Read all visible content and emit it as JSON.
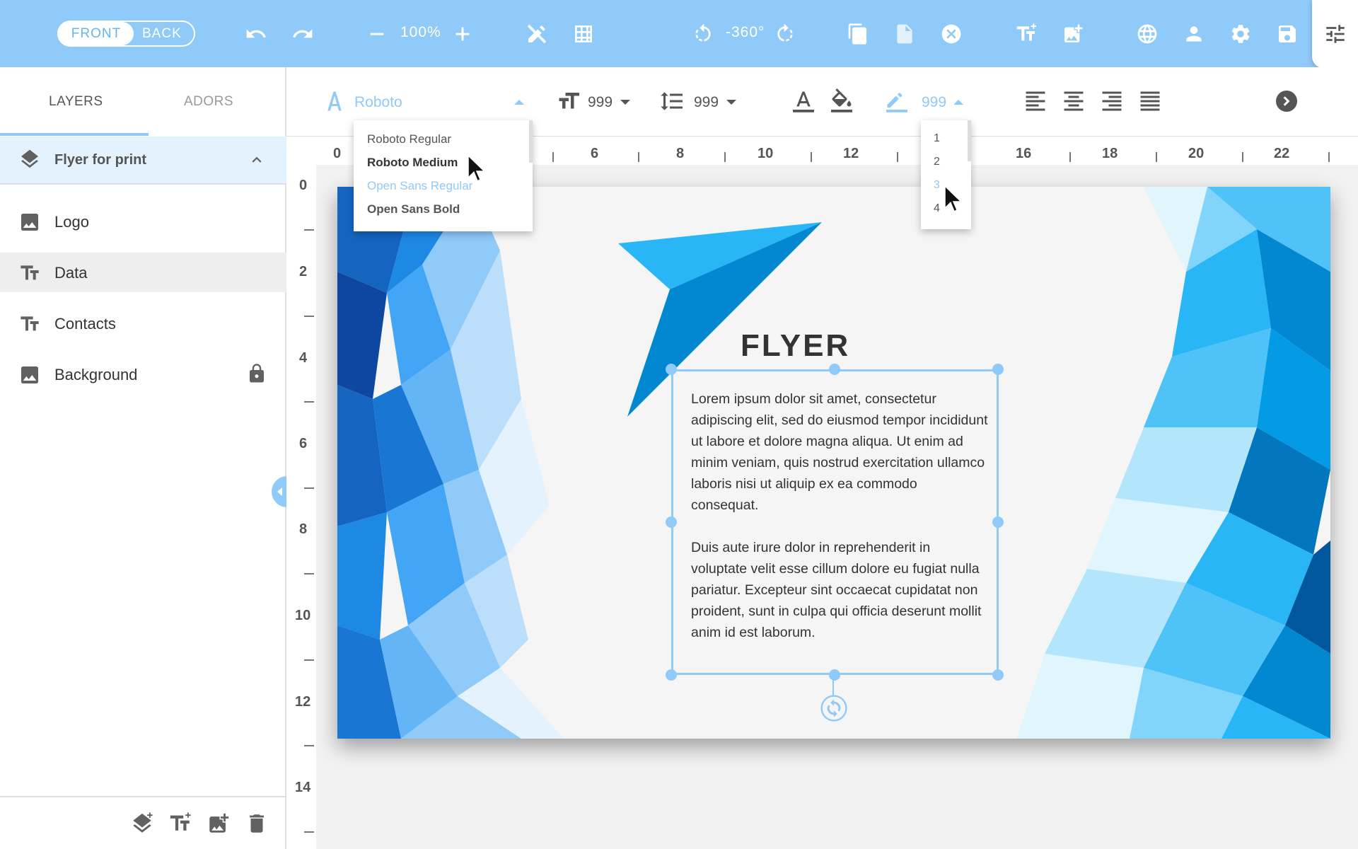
{
  "topbar": {
    "front_label": "FRONT",
    "back_label": "BACK",
    "zoom": "100%",
    "rotation": "-360°"
  },
  "sidebar": {
    "tabs": [
      {
        "label": "LAYERS",
        "active": true
      },
      {
        "label": "ADORS",
        "active": false
      }
    ],
    "group": "Flyer for print",
    "layers": [
      {
        "label": "Logo",
        "icon": "image-icon",
        "selected": false,
        "locked": false
      },
      {
        "label": "Data",
        "icon": "text-icon",
        "selected": true,
        "locked": false
      },
      {
        "label": "Contacts",
        "icon": "text-icon",
        "selected": false,
        "locked": false
      },
      {
        "label": "Background",
        "icon": "image-icon",
        "selected": false,
        "locked": true
      }
    ]
  },
  "formatbar": {
    "font": "Roboto",
    "font_size": "999",
    "line_height": "999",
    "stroke_width": "999",
    "font_options": [
      "Roboto Regular",
      "Roboto Medium",
      "Open Sans Regular",
      "Open Sans Bold"
    ],
    "font_option_hovered": "Open Sans Regular",
    "stroke_options": [
      "1",
      "2",
      "3",
      "4"
    ],
    "stroke_option_hovered": "3"
  },
  "rulers": {
    "top": [
      "0",
      "6",
      "8",
      "10",
      "12",
      "16",
      "18",
      "20",
      "22"
    ],
    "left": [
      "0",
      "2",
      "4",
      "6",
      "8",
      "10",
      "12",
      "14"
    ]
  },
  "canvas": {
    "title": "FLYER",
    "paragraph1": "Lorem ipsum dolor sit amet, consectetur adipiscing elit, sed do eiusmod tempor incididunt ut labore et dolore magna aliqua. Ut enim ad minim veniam, quis nostrud exercitation ullamco laboris nisi ut aliquip ex ea commodo consequat.",
    "paragraph2": "Duis aute irure dolor in reprehenderit in voluptate velit esse cillum dolore eu fugiat nulla pariatur. Excepteur sint occaecat cupidatat non proident, sunt in culpa qui officia deserunt mollit anim id est laborum."
  },
  "colors": {
    "accent": "#90caf9",
    "topbar": "#90caf9",
    "selected_row": "#eeeeee",
    "group_row": "#e3f2fd"
  }
}
